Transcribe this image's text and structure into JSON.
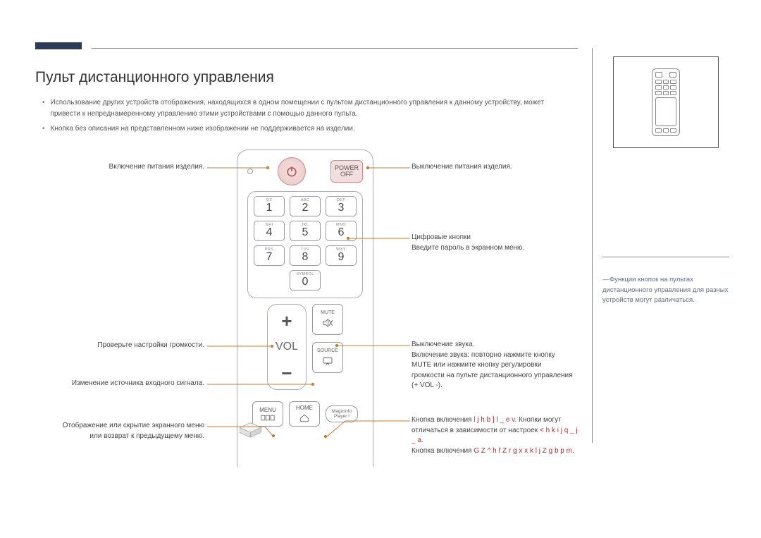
{
  "heading": "Пульт дистанционного управления",
  "bullets": [
    "Использование других устройств отображения, находящихся в одном помещении с пультом дистанционного управления к данному устройству, может привести к непреднамеренному управлению этими устройствами с помощью данного пульта.",
    "Кнопка без описания на представленном ниже изображении не поддерживается на изделии."
  ],
  "remote": {
    "power_off_label": "POWER\nOFF",
    "numpad": [
      {
        "sub": "QZ",
        "num": "1"
      },
      {
        "sub": "ABC",
        "num": "2"
      },
      {
        "sub": "DEF",
        "num": "3"
      },
      {
        "sub": "GHI",
        "num": "4"
      },
      {
        "sub": "JKL",
        "num": "5"
      },
      {
        "sub": "MNO",
        "num": "6"
      },
      {
        "sub": "PRS",
        "num": "7"
      },
      {
        "sub": "TUV",
        "num": "8"
      },
      {
        "sub": "WXY",
        "num": "9"
      },
      {
        "sub": "SYMBOL",
        "num": "0"
      }
    ],
    "vol_label": "VOL",
    "mute_label": "MUTE",
    "source_label": "SOURCE",
    "menu_label": "MENU",
    "home_label": "HOME",
    "magic_label_1": "MagicInfo",
    "magic_label_2": "Player I"
  },
  "callouts": {
    "left": {
      "power_on": "Включение питания изделия.",
      "volume": "Проверьте настройки громкости.",
      "source": "Изменение источника входного сигнала.",
      "menu": "Отображение или скрытие экранного меню или возврат к предыдущему меню."
    },
    "right": {
      "power_off": "Выключение питания изделия.",
      "digits_l1": "Цифровые кнопки",
      "digits_l2": "Введите пароль в экранном меню.",
      "mute_l1": "Выключение звука.",
      "mute_l2": "Включение звука: повторно нажмите кнопку MUTE или нажмите кнопку регулировки громкости на пульте дистанционного управления (+ VOL -).",
      "home_t1": "Кнопка включения ",
      "home_r1": "l j h b ]   l _ e v",
      "home_t2": ". Кнопки могут отличаться в зависимости от настроек ",
      "home_r2": "< h k i j    q _ j _  a",
      "home_t3": ".",
      "home_t4": "Кнопка включения  ",
      "home_r3": "G Z   ^ h f Z r g x x  k l j Z g b p m",
      "home_t5": "."
    }
  },
  "sidenote": "Функции кнопок на пультах дистанционного управления для разных устройств могут различаться."
}
